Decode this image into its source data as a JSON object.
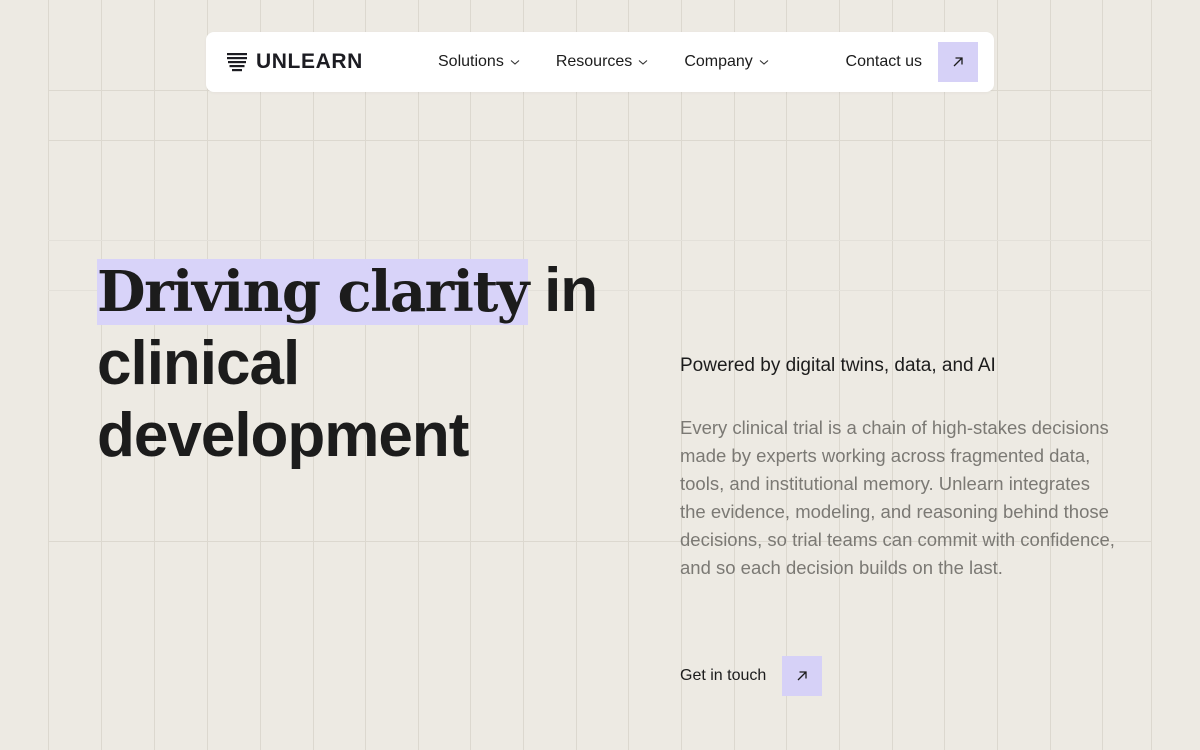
{
  "brand": {
    "name": "UNLEARN"
  },
  "nav": {
    "items": [
      {
        "label": "Solutions"
      },
      {
        "label": "Resources"
      },
      {
        "label": "Company"
      }
    ],
    "contact_label": "Contact us"
  },
  "hero": {
    "headline_highlight": "Driving clarity",
    "headline_rest": " in clinical development",
    "tagline": "Powered by digital twins, data, and AI",
    "body": "Every clinical trial is a chain of high-stakes decisions made by experts working across fragmented data, tools, and institutional memory. Unlearn integrates the evidence, modeling, and reasoning behind those decisions, so trial teams can commit with confidence, and so each decision builds on the last.",
    "cta_label": "Get in touch"
  },
  "colors": {
    "background": "#edeae3",
    "accent": "#d6d1f7",
    "text": "#1c1c1c",
    "muted_text": "#7b7974"
  },
  "icons": [
    "logo-mark-icon",
    "chevron-down-icon",
    "arrow-up-right-icon"
  ]
}
